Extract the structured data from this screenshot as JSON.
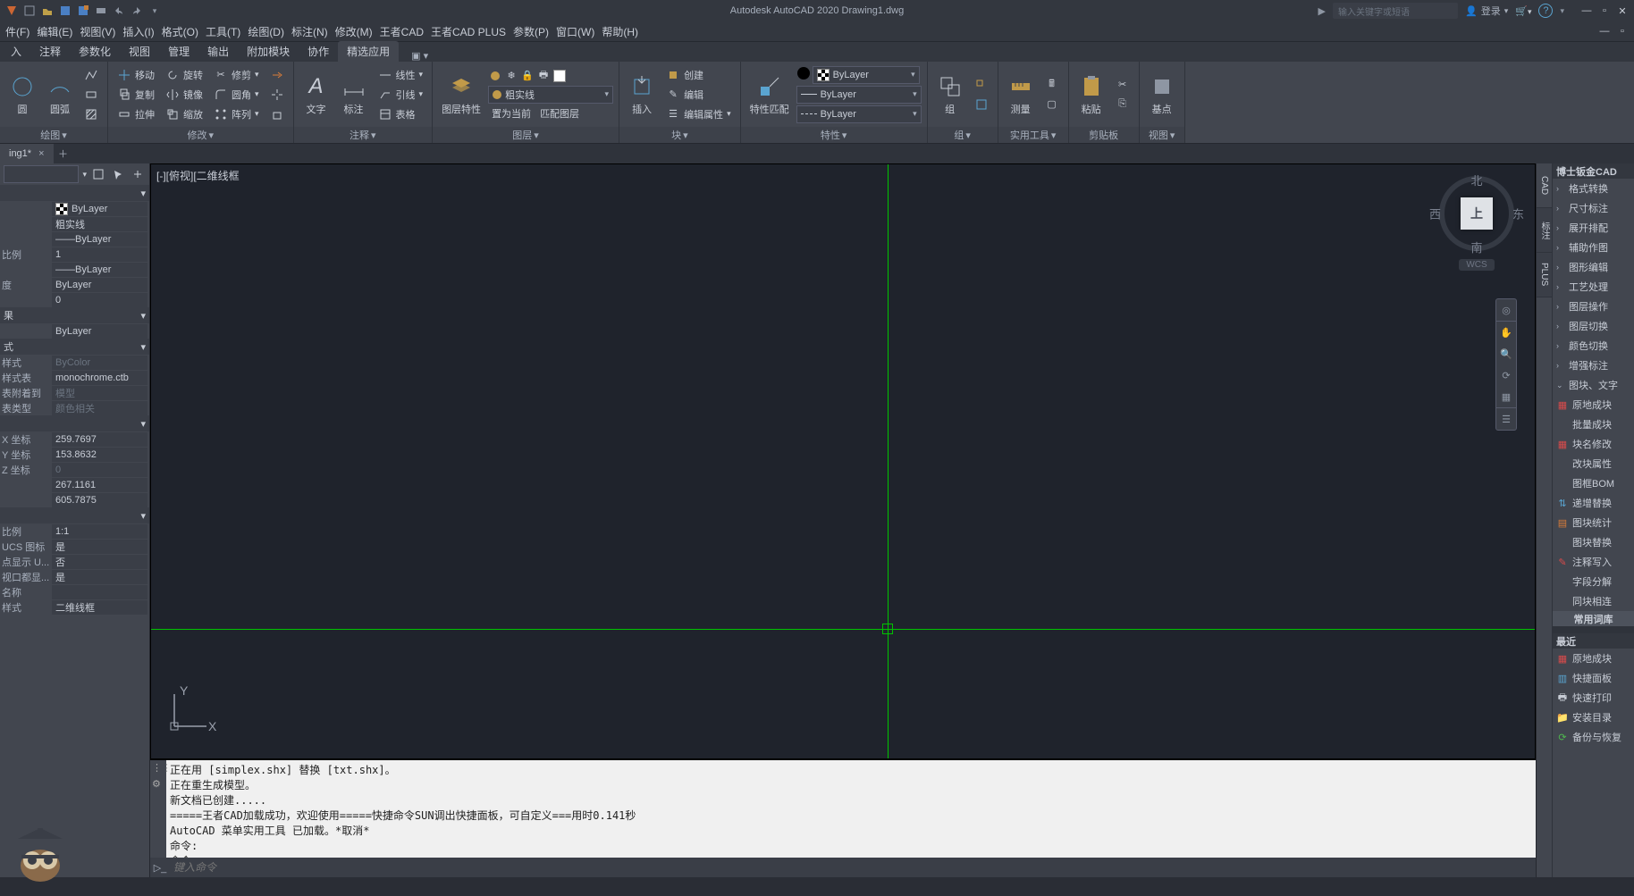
{
  "app": {
    "title": "Autodesk AutoCAD 2020   Drawing1.dwg",
    "search_placeholder": "输入关键字或短语",
    "login": "登录"
  },
  "menu": {
    "items": [
      "件(F)",
      "编辑(E)",
      "视图(V)",
      "插入(I)",
      "格式(O)",
      "工具(T)",
      "绘图(D)",
      "标注(N)",
      "修改(M)",
      "王者CAD",
      "王者CAD PLUS",
      "参数(P)",
      "窗口(W)",
      "帮助(H)"
    ]
  },
  "ribbontabs": {
    "items": [
      "入",
      "注释",
      "参数化",
      "视图",
      "管理",
      "输出",
      "附加模块",
      "协作",
      "精选应用"
    ],
    "active": 0
  },
  "ribbon": {
    "draw": {
      "title": "绘图",
      "btn_circle": "圆",
      "btn_arc": "圆弧"
    },
    "modify": {
      "title": "修改",
      "move": "移动",
      "rotate": "旋转",
      "trim": "修剪",
      "copy": "复制",
      "mirror": "镜像",
      "fillet": "圆角",
      "stretch": "拉伸",
      "scale": "缩放",
      "array": "阵列"
    },
    "annotate": {
      "title": "注释",
      "text": "文字",
      "dim": "标注",
      "linear": "线性",
      "leader": "引线",
      "table": "表格"
    },
    "layers": {
      "title": "图层",
      "layerprop": "图层特性",
      "layercombo": "粗实线",
      "match": "匹配图层",
      "prev": "置为当前"
    },
    "block": {
      "title": "块",
      "insert": "插入",
      "create": "创建",
      "edit": "编辑",
      "editattr": "编辑属性"
    },
    "prop": {
      "title": "特性",
      "match": "特性匹配",
      "c1": "ByLayer",
      "c2": "ByLayer",
      "c3": "ByLayer"
    },
    "group": {
      "title": "组",
      "group": "组"
    },
    "util": {
      "title": "实用工具",
      "measure": "测量"
    },
    "clip": {
      "title": "剪贴板",
      "paste": "粘贴"
    },
    "view": {
      "title": "视图",
      "base": "基点"
    }
  },
  "filetab": {
    "name": "ing1*",
    "addtooltip": "+"
  },
  "props": {
    "layer": "ByLayer",
    "linetype": "粗实线",
    "linetype_val": "ByLayer",
    "scale_label": "比例",
    "scale": "1",
    "lineweight": "ByLayer",
    "thick_label": "度",
    "transparency": "ByLayer",
    "transparency_val": "0",
    "effect_label": "果",
    "material": "ByLayer",
    "style_sec": "式",
    "plotstyle_label": "样式",
    "plotstyle": "ByColor",
    "plottable_label": "样式表",
    "plottable": "monochrome.ctb",
    "plotatt_label": "表附着到",
    "plotatt": "模型",
    "plottype_label": "表类型",
    "plottype": "颜色相关",
    "x_label": "X 坐标",
    "x": "259.7697",
    "y_label": "Y 坐标",
    "y": "153.8632",
    "z_label": "Z 坐标",
    "z": "0",
    "h": "267.1161",
    "w": "605.7875",
    "ascale_label": "比例",
    "ascale": "1:1",
    "ucs_label": "UCS 图标",
    "ucs": "是",
    "orig_label": "点显示 U...",
    "orig": "否",
    "vp_label": "视口都显...",
    "vp": "是",
    "name_label": "名称",
    "name": "",
    "vstyle_label": "样式",
    "vstyle": "二维线框"
  },
  "viewport": {
    "label": "[-][俯视][二维线框"
  },
  "viewcube": {
    "top": "上",
    "n": "北",
    "s": "南",
    "e": "东",
    "w": "西",
    "wcs": "WCS"
  },
  "palette": {
    "title": "博士钣金CAD",
    "tabs": [
      "CAD",
      "标注",
      "PLUS"
    ],
    "cats": [
      "格式转换",
      "尺寸标注",
      "展开排配",
      "辅助作图",
      "图形编辑",
      "工艺处理",
      "图层操作",
      "图层切换",
      "颜色切换",
      "增强标注",
      "图块、文字"
    ],
    "blocks": [
      "原地成块",
      "批量成块",
      "块名修改",
      "改块属性",
      "图框BOM",
      "递增替换",
      "图块统计",
      "图块替换",
      "注释写入",
      "字段分解",
      "同块相连"
    ],
    "lib": "常用词库",
    "recent": "最近",
    "recent_items": [
      "原地成块",
      "快捷面板",
      "快速打印",
      "安装目录",
      "备份与恢复"
    ]
  },
  "cmd": {
    "history": "正在用 [simplex.shx] 替换 [txt.shx]。\n正在重生成模型。\n新文档已创建.....\n=====王者CAD加载成功，欢迎使用=====快捷命令SUN调出快捷面板，可自定义===用时0.141秒\nAutoCAD 菜单实用工具 已加载。*取消*\n命令:\n命令:\n命令:",
    "prompt": "键入命令"
  }
}
